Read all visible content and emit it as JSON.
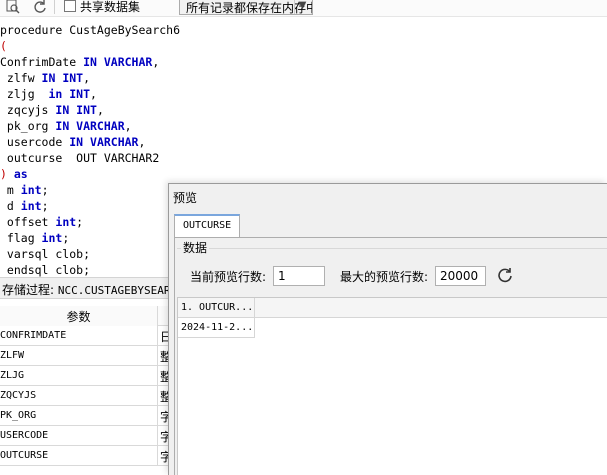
{
  "toolbar": {
    "share_dataset_label": "共享数据集",
    "share_dataset_checked": false,
    "cache_mode_value": "所有记录都保存在内存中"
  },
  "editor": {
    "lines": [
      "procedure CustAgeBySearch6",
      "(",
      "ConfrimDate IN VARCHAR,",
      " zlfw IN INT,",
      " zljg  in INT,",
      " zqcyjs IN INT,",
      " pk_org IN VARCHAR,",
      " usercode IN VARCHAR,",
      " outcurse  OUT VARCHAR2",
      ") as",
      " m int;",
      " d int;",
      " offset int;",
      " flag int;",
      " varsql clob;",
      " endsql clob;"
    ]
  },
  "procedure_panel": {
    "label": "存储过程:",
    "name": "NCC.CUSTAGEBYSEARC"
  },
  "params_table": {
    "header": "参数",
    "header_col2": "",
    "rows": [
      {
        "name": "CONFRIMDATE",
        "type": "日"
      },
      {
        "name": "ZLFW",
        "type": "整"
      },
      {
        "name": "ZLJG",
        "type": "整"
      },
      {
        "name": "ZQCYJS",
        "type": "整"
      },
      {
        "name": "PK_ORG",
        "type": "字"
      },
      {
        "name": "USERCODE",
        "type": "字"
      },
      {
        "name": "OUTCURSE",
        "type": "字"
      }
    ]
  },
  "preview_dialog": {
    "title": "预览",
    "tab_label": "OUTCURSE",
    "group_label": "数据",
    "current_rows_label": "当前预览行数:",
    "current_rows_value": "1",
    "max_rows_label": "最大的预览行数:",
    "max_rows_value": "20000",
    "grid": {
      "columns": [
        "1. OUTCUR..."
      ],
      "rows": [
        [
          "2024-11-2..."
        ]
      ]
    }
  },
  "icons": {
    "toolbar_preview": "preview-icon",
    "toolbar_refresh": "refresh-icon",
    "dialog_refresh": "refresh-icon"
  },
  "colors": {
    "keyword": "#0000c0",
    "paren": "#c00000",
    "tab_accent": "#7aa6dd"
  }
}
